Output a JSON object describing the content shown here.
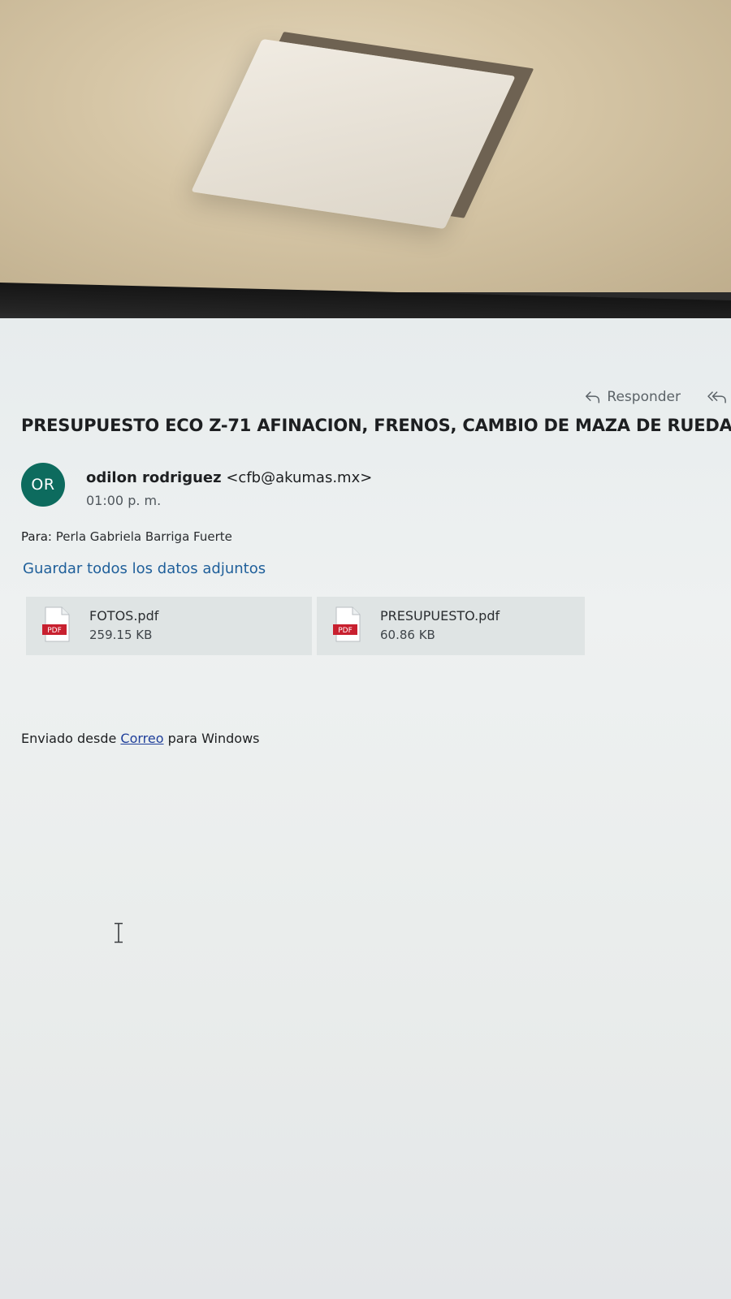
{
  "toolbar": {
    "reply_label": "Responder"
  },
  "message": {
    "subject": "PRESUPUESTO ECO Z-71 AFINACION, FRENOS, CAMBIO DE MAZA DE RUEDA",
    "avatar_initials": "OR",
    "sender_name": "odilon rodriguez",
    "sender_email": "<cfb@akumas.mx>",
    "time": "01:00 p. m.",
    "to_label": "Para:",
    "to_value": "Perla Gabriela Barriga Fuerte",
    "save_all_label": "Guardar todos los datos adjuntos"
  },
  "attachments": [
    {
      "name": "FOTOS.pdf",
      "size": "259.15 KB",
      "type_label": "PDF"
    },
    {
      "name": "PRESUPUESTO.pdf",
      "size": "60.86 KB",
      "type_label": "PDF"
    }
  ],
  "body": {
    "prefix": "Enviado desde ",
    "link": "Correo",
    "suffix": " para Windows"
  },
  "colors": {
    "avatar": "#0d6b5e",
    "link": "#1f5f9a",
    "pdf_red": "#c8202f"
  },
  "icons": {
    "reply": "reply-icon",
    "reply_all": "reply-all-icon",
    "pdf": "pdf-file-icon",
    "cursor": "text-cursor-icon"
  }
}
